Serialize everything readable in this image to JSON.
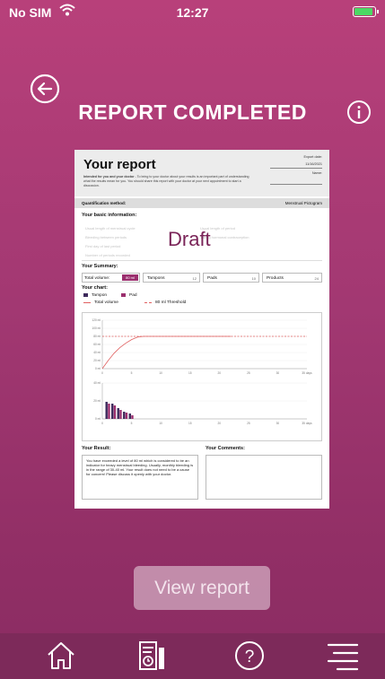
{
  "status_bar": {
    "carrier": "No SIM",
    "time": "12:27"
  },
  "header": {
    "title": "REPORT COMPLETED"
  },
  "report": {
    "title": "Your report",
    "subtitle_bold": "Intended for you and your doctor",
    "subtitle_rest": " - To bring to your doctor about your results is an important part of understanding what the results mean for you. You should share this report with your doctor at your next appointment to start a discussion.",
    "export_date_label": "Export date:",
    "export_date_value": "11/16/2021",
    "name_label": "Name:",
    "quant_method_label": "Quantification method:",
    "quant_method_value": "Menstrual Pictogram",
    "basic_info_heading": "Your basic information:",
    "basic_info_lines": [
      "Usual length of menstrual cycle",
      "Usual length of period",
      "Bleeding between periods",
      "Taking hormonal contraception",
      "First day of last period",
      "Number of periods recorded"
    ],
    "watermark": "Draft",
    "summary_heading": "Your Summary:",
    "summary": [
      {
        "label": "Total volume:",
        "value": "80 ml"
      },
      {
        "label": "Tampons",
        "value": "12"
      },
      {
        "label": "Pads",
        "value": "10"
      },
      {
        "label": "Products",
        "value": "24"
      }
    ],
    "chart_heading": "Your chart:",
    "legend": {
      "tampon": "Tampon",
      "pad": "Pad",
      "total": "Total volume",
      "threshold": "80 ml Threshold"
    },
    "result_heading": "Your Result:",
    "result_text": "You have exceeded a level of 80 ml which is considered to be an indicator for heavy menstrual bleeding. Usually, monthly bleeding is in the range of 30-40 ml. Your result does not need to be a cause for concern! Please discuss it openly with your doctor.",
    "comments_heading": "Your Comments:"
  },
  "chart_data": [
    {
      "type": "line",
      "x": [
        0,
        1,
        2,
        3,
        4,
        5,
        6,
        7,
        8,
        9,
        10,
        11,
        12,
        13,
        14,
        15,
        16,
        17,
        18,
        19,
        20,
        21,
        22
      ],
      "series": [
        {
          "name": "Total volume",
          "values": [
            0,
            20,
            38,
            52,
            63,
            72,
            78,
            80,
            80,
            80,
            80,
            80,
            80,
            80,
            80,
            80,
            80,
            80,
            80,
            80,
            80,
            80,
            80
          ]
        },
        {
          "name": "80 ml Threshold",
          "values": [
            80,
            80,
            80,
            80,
            80,
            80,
            80,
            80,
            80,
            80,
            80,
            80,
            80,
            80,
            80,
            80,
            80,
            80,
            80,
            80,
            80,
            80,
            80
          ]
        }
      ],
      "ylim": [
        0,
        120
      ],
      "xlim": [
        0,
        35
      ],
      "y_ticks": [
        "0 ml",
        "20 ml",
        "40 ml",
        "60 ml",
        "80 ml",
        "100 ml",
        "120 ml"
      ],
      "x_ticks": [
        "0",
        "5",
        "10",
        "15",
        "20",
        "25",
        "30",
        "35 days"
      ]
    },
    {
      "type": "bar",
      "x": [
        1,
        2,
        3,
        4,
        5
      ],
      "series": [
        {
          "name": "Tampon",
          "values": [
            19,
            17,
            12,
            8,
            6
          ]
        },
        {
          "name": "Pad",
          "values": [
            17,
            15,
            10,
            7,
            4
          ]
        }
      ],
      "ylim": [
        0,
        40
      ],
      "y_ticks": [
        "0 ml",
        "20 ml",
        "40 ml"
      ],
      "x_ticks": [
        "0",
        "5",
        "10",
        "15",
        "20",
        "25",
        "30",
        "35 days"
      ]
    }
  ],
  "footer": {
    "view_report_label": "View report"
  },
  "tabbar": {
    "items": [
      "home-icon",
      "report-icon",
      "help-icon",
      "menu-icon"
    ]
  },
  "colors": {
    "accent": "#9b2f6e",
    "tampon": "#3d2a5c",
    "pad": "#9b2f6e",
    "line": "#e06060",
    "disabled_button": "#c98fae"
  }
}
